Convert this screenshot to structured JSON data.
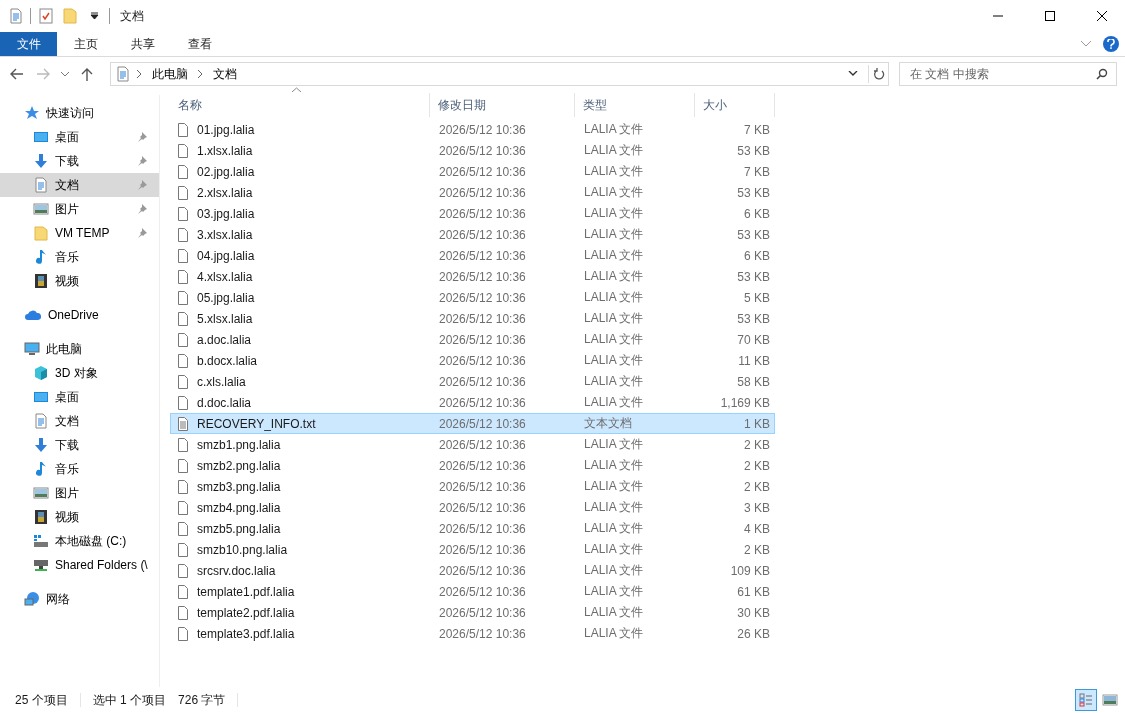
{
  "window": {
    "title": "文档"
  },
  "ribbon_tabs": [
    {
      "label": "文件",
      "selected": true
    },
    {
      "label": "主页",
      "selected": false
    },
    {
      "label": "共享",
      "selected": false
    },
    {
      "label": "查看",
      "selected": false
    }
  ],
  "address": {
    "path": [
      "此电脑",
      "文档"
    ]
  },
  "search": {
    "placeholder": "在 文档 中搜索"
  },
  "nav": [
    {
      "label": "快速访问",
      "kind": "star",
      "children": [
        {
          "label": "桌面",
          "kind": "desktop",
          "pinned": true,
          "selected": false
        },
        {
          "label": "下载",
          "kind": "download",
          "pinned": true,
          "selected": false
        },
        {
          "label": "文档",
          "kind": "doc",
          "pinned": true,
          "selected": true
        },
        {
          "label": "图片",
          "kind": "picture",
          "pinned": true,
          "selected": false
        },
        {
          "label": "VM TEMP",
          "kind": "folder",
          "pinned": true,
          "selected": false
        },
        {
          "label": "音乐",
          "kind": "music",
          "pinned": false,
          "selected": false
        },
        {
          "label": "视频",
          "kind": "video",
          "pinned": false,
          "selected": false
        }
      ]
    },
    {
      "label": "OneDrive",
      "kind": "cloud"
    },
    {
      "label": "此电脑",
      "kind": "pc",
      "children": [
        {
          "label": "3D 对象",
          "kind": "cube",
          "pinned": false,
          "selected": false
        },
        {
          "label": "桌面",
          "kind": "desktop",
          "pinned": false,
          "selected": false
        },
        {
          "label": "文档",
          "kind": "doc",
          "pinned": false,
          "selected": false
        },
        {
          "label": "下载",
          "kind": "download",
          "pinned": false,
          "selected": false
        },
        {
          "label": "音乐",
          "kind": "music",
          "pinned": false,
          "selected": false
        },
        {
          "label": "图片",
          "kind": "picture",
          "pinned": false,
          "selected": false
        },
        {
          "label": "视频",
          "kind": "video",
          "pinned": false,
          "selected": false
        },
        {
          "label": "本地磁盘 (C:)",
          "kind": "drive",
          "pinned": false,
          "selected": false
        },
        {
          "label": "Shared Folders (\\",
          "kind": "netdrive",
          "pinned": false,
          "selected": false
        }
      ]
    },
    {
      "label": "网络",
      "kind": "network"
    }
  ],
  "columns": [
    {
      "label": "名称",
      "sorted": true
    },
    {
      "label": "修改日期",
      "sorted": false
    },
    {
      "label": "类型",
      "sorted": false
    },
    {
      "label": "大小",
      "sorted": false
    }
  ],
  "files": [
    {
      "name": "01.jpg.lalia",
      "date": "2026/5/12 10:36",
      "type": "LALIA 文件",
      "size": "7 KB",
      "kind": "blank",
      "selected": false
    },
    {
      "name": "1.xlsx.lalia",
      "date": "2026/5/12 10:36",
      "type": "LALIA 文件",
      "size": "53 KB",
      "kind": "blank",
      "selected": false
    },
    {
      "name": "02.jpg.lalia",
      "date": "2026/5/12 10:36",
      "type": "LALIA 文件",
      "size": "7 KB",
      "kind": "blank",
      "selected": false
    },
    {
      "name": "2.xlsx.lalia",
      "date": "2026/5/12 10:36",
      "type": "LALIA 文件",
      "size": "53 KB",
      "kind": "blank",
      "selected": false
    },
    {
      "name": "03.jpg.lalia",
      "date": "2026/5/12 10:36",
      "type": "LALIA 文件",
      "size": "6 KB",
      "kind": "blank",
      "selected": false
    },
    {
      "name": "3.xlsx.lalia",
      "date": "2026/5/12 10:36",
      "type": "LALIA 文件",
      "size": "53 KB",
      "kind": "blank",
      "selected": false
    },
    {
      "name": "04.jpg.lalia",
      "date": "2026/5/12 10:36",
      "type": "LALIA 文件",
      "size": "6 KB",
      "kind": "blank",
      "selected": false
    },
    {
      "name": "4.xlsx.lalia",
      "date": "2026/5/12 10:36",
      "type": "LALIA 文件",
      "size": "53 KB",
      "kind": "blank",
      "selected": false
    },
    {
      "name": "05.jpg.lalia",
      "date": "2026/5/12 10:36",
      "type": "LALIA 文件",
      "size": "5 KB",
      "kind": "blank",
      "selected": false
    },
    {
      "name": "5.xlsx.lalia",
      "date": "2026/5/12 10:36",
      "type": "LALIA 文件",
      "size": "53 KB",
      "kind": "blank",
      "selected": false
    },
    {
      "name": "a.doc.lalia",
      "date": "2026/5/12 10:36",
      "type": "LALIA 文件",
      "size": "70 KB",
      "kind": "blank",
      "selected": false
    },
    {
      "name": "b.docx.lalia",
      "date": "2026/5/12 10:36",
      "type": "LALIA 文件",
      "size": "11 KB",
      "kind": "blank",
      "selected": false
    },
    {
      "name": "c.xls.lalia",
      "date": "2026/5/12 10:36",
      "type": "LALIA 文件",
      "size": "58 KB",
      "kind": "blank",
      "selected": false
    },
    {
      "name": "d.doc.lalia",
      "date": "2026/5/12 10:36",
      "type": "LALIA 文件",
      "size": "1,169 KB",
      "kind": "blank",
      "selected": false
    },
    {
      "name": "RECOVERY_INFO.txt",
      "date": "2026/5/12 10:36",
      "type": "文本文档",
      "size": "1 KB",
      "kind": "text",
      "selected": true
    },
    {
      "name": "smzb1.png.lalia",
      "date": "2026/5/12 10:36",
      "type": "LALIA 文件",
      "size": "2 KB",
      "kind": "blank",
      "selected": false
    },
    {
      "name": "smzb2.png.lalia",
      "date": "2026/5/12 10:36",
      "type": "LALIA 文件",
      "size": "2 KB",
      "kind": "blank",
      "selected": false
    },
    {
      "name": "smzb3.png.lalia",
      "date": "2026/5/12 10:36",
      "type": "LALIA 文件",
      "size": "2 KB",
      "kind": "blank",
      "selected": false
    },
    {
      "name": "smzb4.png.lalia",
      "date": "2026/5/12 10:36",
      "type": "LALIA 文件",
      "size": "3 KB",
      "kind": "blank",
      "selected": false
    },
    {
      "name": "smzb5.png.lalia",
      "date": "2026/5/12 10:36",
      "type": "LALIA 文件",
      "size": "4 KB",
      "kind": "blank",
      "selected": false
    },
    {
      "name": "smzb10.png.lalia",
      "date": "2026/5/12 10:36",
      "type": "LALIA 文件",
      "size": "2 KB",
      "kind": "blank",
      "selected": false
    },
    {
      "name": "srcsrv.doc.lalia",
      "date": "2026/5/12 10:36",
      "type": "LALIA 文件",
      "size": "109 KB",
      "kind": "blank",
      "selected": false
    },
    {
      "name": "template1.pdf.lalia",
      "date": "2026/5/12 10:36",
      "type": "LALIA 文件",
      "size": "61 KB",
      "kind": "blank",
      "selected": false
    },
    {
      "name": "template2.pdf.lalia",
      "date": "2026/5/12 10:36",
      "type": "LALIA 文件",
      "size": "30 KB",
      "kind": "blank",
      "selected": false
    },
    {
      "name": "template3.pdf.lalia",
      "date": "2026/5/12 10:36",
      "type": "LALIA 文件",
      "size": "26 KB",
      "kind": "blank",
      "selected": false
    }
  ],
  "status_bar": {
    "count": "25 个项目",
    "selection": "选中 1 个项目",
    "size": "726 字节"
  },
  "view_buttons": [
    {
      "kind": "details",
      "selected": true
    },
    {
      "kind": "thumbnails",
      "selected": false
    }
  ]
}
